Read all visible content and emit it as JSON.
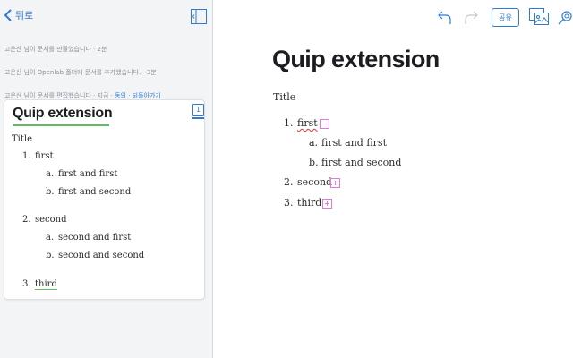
{
  "sidebar": {
    "back_label": "뒤로",
    "history": [
      {
        "text": "고은산 님이 문서를 만들었습니다 · 2분",
        "links": []
      },
      {
        "text": "고은산 님이 Openlab 폴더에 문서를 추가했습니다. · 3분",
        "links": []
      },
      {
        "text": "고은산 님이 문서를 편집했습니다 · 지금 · ",
        "links": [
          "동의",
          "되돌아가기"
        ]
      }
    ],
    "card": {
      "title": "Quip extension",
      "badge": "1",
      "heading": "Title",
      "items": [
        {
          "num": "1.",
          "text": "first",
          "sub": [
            {
              "num": "a.",
              "text": "first and first"
            },
            {
              "num": "b.",
              "text": "first and second"
            }
          ]
        },
        {
          "num": "2.",
          "text": "second",
          "sub": [
            {
              "num": "a.",
              "text": "second and first"
            },
            {
              "num": "b.",
              "text": "second and second"
            }
          ]
        },
        {
          "num": "3.",
          "text": "third",
          "sub": []
        }
      ]
    }
  },
  "toolbar": {
    "share_label": "공유",
    "icons": [
      "undo-icon",
      "redo-icon",
      "image-gallery-icon",
      "settings-icon"
    ]
  },
  "document": {
    "title": "Quip extension",
    "heading": "Title",
    "items": [
      {
        "num": "1.",
        "text": "first",
        "sub": [
          {
            "num": "a.",
            "text": "first and first"
          },
          {
            "num": "b.",
            "text": "first and second"
          }
        ]
      },
      {
        "num": "2.",
        "text": "second",
        "sub": []
      },
      {
        "num": "3.",
        "text": "third",
        "sub": []
      }
    ]
  },
  "colors": {
    "accent": "#2e7bd6",
    "toggle": "#e37ad6",
    "spell": "#e0392f",
    "edit_underline": "#5cc05c"
  }
}
